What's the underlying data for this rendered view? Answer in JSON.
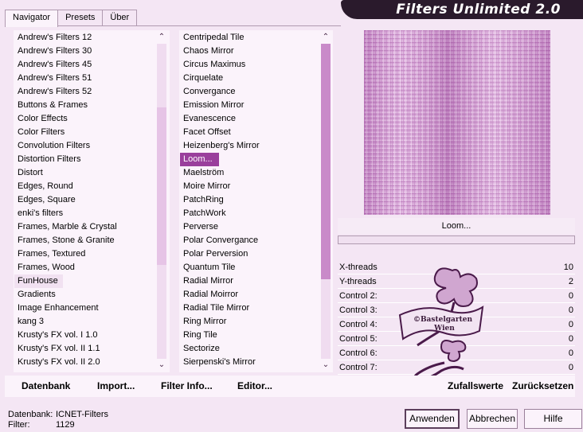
{
  "window": {
    "title": "Filters Unlimited 2.0",
    "tabs": [
      "Navigator",
      "Presets",
      "Über"
    ],
    "active_tab": 0
  },
  "categories": {
    "items": [
      "Andrew's Filters 12",
      "Andrew's Filters 30",
      "Andrew's Filters 45",
      "Andrew's Filters 51",
      "Andrew's Filters 52",
      "Buttons & Frames",
      "Color Effects",
      "Color Filters",
      "Convolution Filters",
      "Distortion Filters",
      "Distort",
      "Edges, Round",
      "Edges, Square",
      "enki's filters",
      "Frames, Marble & Crystal",
      "Frames, Stone & Granite",
      "Frames, Textured",
      "Frames, Wood",
      "FunHouse",
      "Gradients",
      "Image Enhancement",
      "kang 3",
      "Krusty's FX vol. I 1.0",
      "Krusty's FX vol. II 1.1",
      "Krusty's FX vol. II 2.0"
    ],
    "highlighted": "FunHouse"
  },
  "filters": {
    "items": [
      "Centripedal Tile",
      "Chaos Mirror",
      "Circus Maximus",
      "Cirquelate",
      "Convergance",
      "Emission Mirror",
      "Evanescence",
      "Facet Offset",
      "Heizenberg's Mirror",
      "Loom...",
      "Maelström",
      "Moire Mirror",
      "PatchRing",
      "PatchWork",
      "Perverse",
      "Polar Convergance",
      "Polar Perversion",
      "Quantum Tile",
      "Radial Mirror",
      "Radial Moirror",
      "Radial Tile Mirror",
      "Ring Mirror",
      "Ring Tile",
      "Sectorize",
      "Sierpenski's Mirror"
    ],
    "selected": "Loom..."
  },
  "preview": {
    "filter_name": "Loom...",
    "progress": 0
  },
  "parameters": [
    {
      "name": "X-threads",
      "value": "10"
    },
    {
      "name": "Y-threads",
      "value": "2"
    },
    {
      "name": "Control 2:",
      "value": "0"
    },
    {
      "name": "Control 3:",
      "value": "0"
    },
    {
      "name": "Control 4:",
      "value": "0"
    },
    {
      "name": "Control 5:",
      "value": "0"
    },
    {
      "name": "Control 6:",
      "value": "0"
    },
    {
      "name": "Control 7:",
      "value": "0"
    }
  ],
  "watermark": {
    "text_line1": "©Bastelgarten",
    "text_line2": "Wien"
  },
  "toolbar": {
    "database": "Datenbank",
    "import": "Import...",
    "filter_info": "Filter Info...",
    "editor": "Editor...",
    "random": "Zufallswerte",
    "reset": "Zurücksetzen"
  },
  "status": {
    "db_label": "Datenbank:",
    "db_value": "ICNET-Filters",
    "filter_label": "Filter:",
    "filter_value": "1129"
  },
  "buttons": {
    "apply": "Anwenden",
    "cancel": "Abbrechen",
    "help": "Hilfe"
  },
  "colors": {
    "background": "#f4e6f4",
    "panel": "#fbf3fb",
    "selection": "#9a3f9c",
    "scroll_thumb": "#c98ac9",
    "title_bar": "#2a1a2c"
  }
}
